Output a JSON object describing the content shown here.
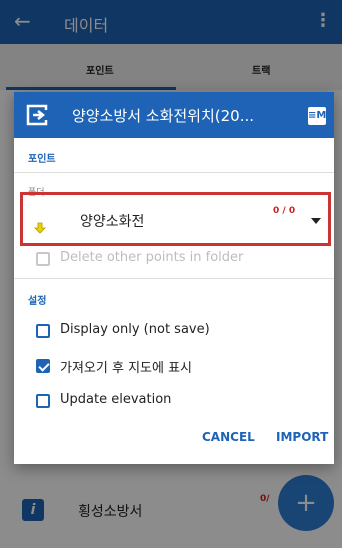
{
  "appbar": {
    "title": "데이터"
  },
  "tabs": [
    "포인트",
    "트랙"
  ],
  "background_list": [
    {
      "label": "",
      "count": ""
    },
    {
      "label": "횡성소방서",
      "count": "0/"
    }
  ],
  "fab": {
    "label": "+"
  },
  "dialog": {
    "title": "양양소방서 소화전위치(20...",
    "section_points": "포인트",
    "folder_label": "폴더",
    "folder_value": "양양소화전",
    "folder_count": "0 / 0",
    "delete_label": "Delete other points in folder",
    "section_settings": "설정",
    "options": [
      {
        "label": "Display only (not save)",
        "checked": false
      },
      {
        "label": "가져오기 후 지도에 표시",
        "checked": true
      },
      {
        "label": "Update elevation",
        "checked": false
      }
    ],
    "cancel_label": "CANCEL",
    "import_label": "IMPORT"
  },
  "colors": {
    "primary": "#1e63b6",
    "highlight": "#cc3333",
    "count": "#c22"
  }
}
